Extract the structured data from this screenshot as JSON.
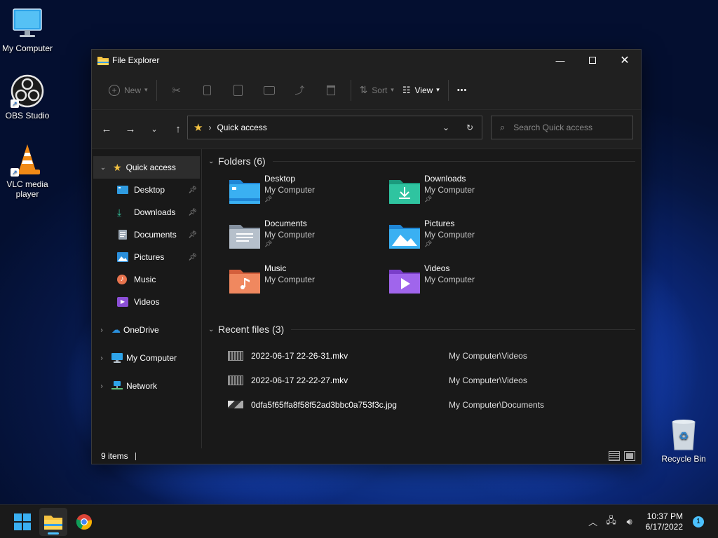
{
  "desktop": {
    "icons": [
      {
        "label": "My Computer"
      },
      {
        "label": "OBS Studio"
      },
      {
        "label": "VLC media player"
      },
      {
        "label": "Recycle Bin"
      }
    ]
  },
  "window": {
    "title": "File Explorer",
    "commands": {
      "new": "New",
      "sort": "Sort",
      "view": "View",
      "more": "•••"
    },
    "address": "Quick access",
    "search_placeholder": "Search Quick access"
  },
  "sidebar": {
    "items": [
      {
        "label": "Quick access"
      },
      {
        "label": "Desktop"
      },
      {
        "label": "Downloads"
      },
      {
        "label": "Documents"
      },
      {
        "label": "Pictures"
      },
      {
        "label": "Music"
      },
      {
        "label": "Videos"
      },
      {
        "label": "OneDrive"
      },
      {
        "label": "My Computer"
      },
      {
        "label": "Network"
      }
    ]
  },
  "folders_section": {
    "title": "Folders (6)",
    "items": [
      {
        "name": "Desktop",
        "location": "My Computer"
      },
      {
        "name": "Downloads",
        "location": "My Computer"
      },
      {
        "name": "Documents",
        "location": "My Computer"
      },
      {
        "name": "Pictures",
        "location": "My Computer"
      },
      {
        "name": "Music",
        "location": "My Computer"
      },
      {
        "name": "Videos",
        "location": "My Computer"
      }
    ]
  },
  "recent_section": {
    "title": "Recent files (3)",
    "items": [
      {
        "name": "2022-06-17 22-26-31.mkv",
        "path": "My Computer\\Videos"
      },
      {
        "name": "2022-06-17 22-22-27.mkv",
        "path": "My Computer\\Videos"
      },
      {
        "name": "0dfa5f65ffa8f58f52ad3bbc0a753f3c.jpg",
        "path": "My Computer\\Documents"
      }
    ]
  },
  "status": {
    "items": "9 items"
  },
  "taskbar": {
    "time": "10:37 PM",
    "date": "6/17/2022",
    "notifications": "1"
  },
  "colors": {
    "accent": "#4cc2ff",
    "window_bg": "#191919",
    "chrome_bg": "#202020",
    "folder_blue": "#3aa0e8"
  }
}
